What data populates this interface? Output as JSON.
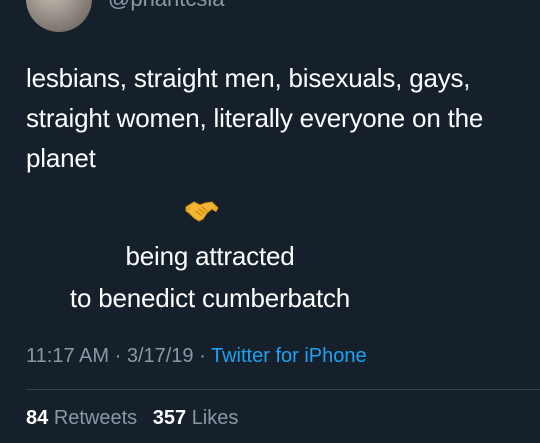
{
  "tweet": {
    "handle": "@phantcsia",
    "text": "lesbians, straight men, bisexuals, gays, straight women, literally everyone on the planet",
    "emoji": "handshake-icon",
    "caption_line1": "being attracted",
    "caption_line2": "to benedict cumberbatch"
  },
  "meta": {
    "time": "11:17 AM",
    "separator": "·",
    "date": "3/17/19",
    "source": "Twitter for iPhone"
  },
  "stats": {
    "retweets_count": "84",
    "retweets_label": "Retweets",
    "likes_count": "357",
    "likes_label": "Likes"
  },
  "colors": {
    "background": "#15202b",
    "text": "#ffffff",
    "secondary": "#8899a6",
    "link": "#1da1f2",
    "divider": "#38444d"
  }
}
